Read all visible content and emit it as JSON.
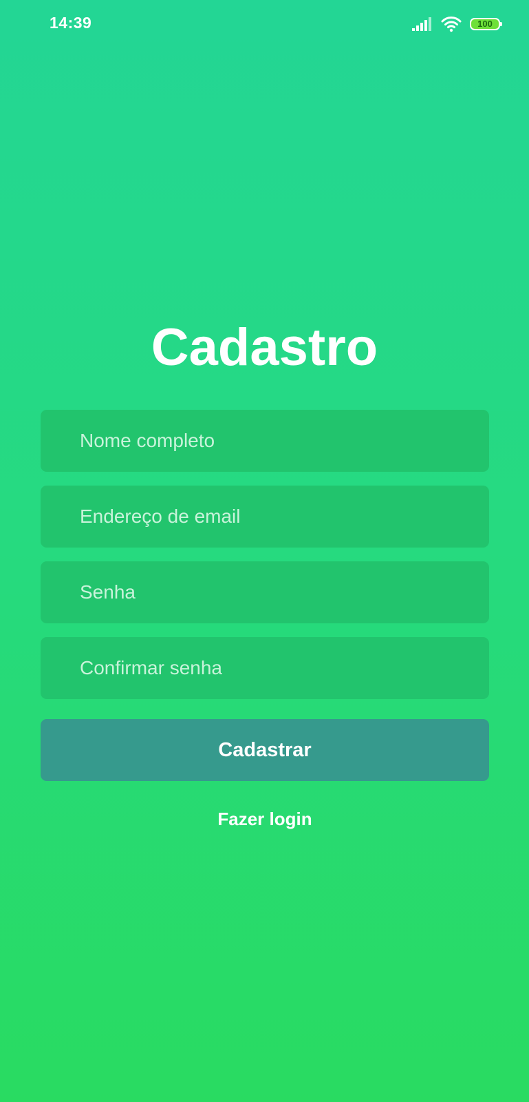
{
  "status_bar": {
    "time": "14:39",
    "battery_level": "100",
    "icons": [
      "signal-icon",
      "wifi-icon",
      "battery-icon"
    ]
  },
  "title": "Cadastro",
  "form": {
    "name_placeholder": "Nome completo",
    "email_placeholder": "Endereço de email",
    "password_placeholder": "Senha",
    "confirm_password_placeholder": "Confirmar senha",
    "submit_label": "Cadastrar",
    "login_link_label": "Fazer login"
  },
  "colors": {
    "background_top": "#23d695",
    "background_bottom": "#29db61",
    "field_background": "#22c46d",
    "button_background": "#369a8d",
    "text": "#ffffff"
  }
}
